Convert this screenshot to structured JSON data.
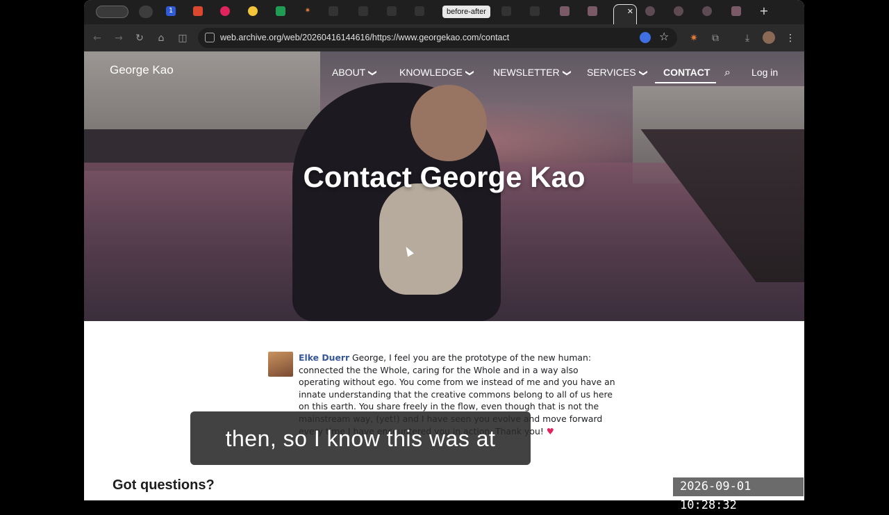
{
  "browser": {
    "tabs": {
      "active_label": "before-after",
      "close_glyph": "✕",
      "new_tab_glyph": "+"
    },
    "toolbar": {
      "back_glyph": "←",
      "forward_glyph": "→",
      "reload_glyph": "↻",
      "home_glyph": "⌂",
      "split_glyph": "◫",
      "url": "web.archive.org/web/20260416144616/https://www.georgekao.com/contact",
      "star_glyph": "☆",
      "menu_glyph": "⋮"
    }
  },
  "site": {
    "title": "George Kao",
    "nav": {
      "about": "ABOUT",
      "knowledge": "KNOWLEDGE",
      "newsletter": "NEWSLETTER",
      "services": "SERVICES",
      "contact": "CONTACT",
      "login": "Log in"
    },
    "chevron": "❯",
    "hero_title": "Contact George Kao"
  },
  "testimonial": {
    "name": "Elke Duerr",
    "text": " George, I feel you are the prototype of the new human: connected the the Whole, caring for the Whole and in a way also operating without ego. You come from we instead of me and you have an innate understanding that the creative commons belong to all of us here on this earth. You share freely in the flow, even though that is not the mainstream way, (yet!) and I have seen you evolve and move forward every time I have encountered you in action. Thank you! ",
    "heart": "♥"
  },
  "caption": "then, so I know this was at",
  "section_heading": "Got questions?",
  "timestamp": "2026-09-01  10:28:32",
  "colors": {
    "tabbar": "#1f1f1f",
    "toolbar": "#2b2b2b",
    "name_link": "#365899",
    "heart": "#e0245e"
  }
}
